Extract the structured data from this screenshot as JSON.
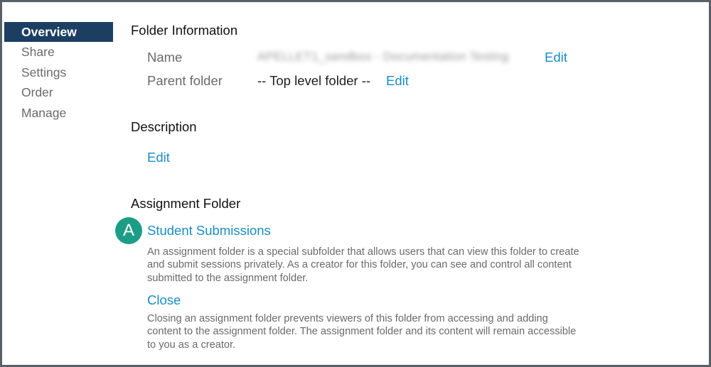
{
  "sidebar": {
    "items": [
      {
        "label": "Overview",
        "active": true
      },
      {
        "label": "Share",
        "active": false
      },
      {
        "label": "Settings",
        "active": false
      },
      {
        "label": "Order",
        "active": false
      },
      {
        "label": "Manage",
        "active": false
      }
    ]
  },
  "folder_info": {
    "title": "Folder Information",
    "name_label": "Name",
    "name_value": "APELLET1_sandbox - Documentation Testing",
    "name_edit": "Edit",
    "parent_label": "Parent folder",
    "parent_value": "-- Top level folder --",
    "parent_edit": "Edit"
  },
  "description": {
    "title": "Description",
    "edit": "Edit"
  },
  "assignment": {
    "title": "Assignment Folder",
    "badge": "A",
    "student_submissions_link": "Student Submissions",
    "student_submissions_help": "An assignment folder is a special subfolder that allows users that can view this folder to create and submit sessions privately. As a creator for this folder, you can see and control all content submitted to the assignment folder.",
    "close_link": "Close",
    "close_help": "Closing an assignment folder prevents viewers of this folder from accessing and adding content to the assignment folder. The assignment folder and its content will remain accessible to you as a creator."
  },
  "colors": {
    "nav_active_bg": "#1c3e63",
    "link": "#1a8cc2",
    "badge": "#1d9d85"
  }
}
